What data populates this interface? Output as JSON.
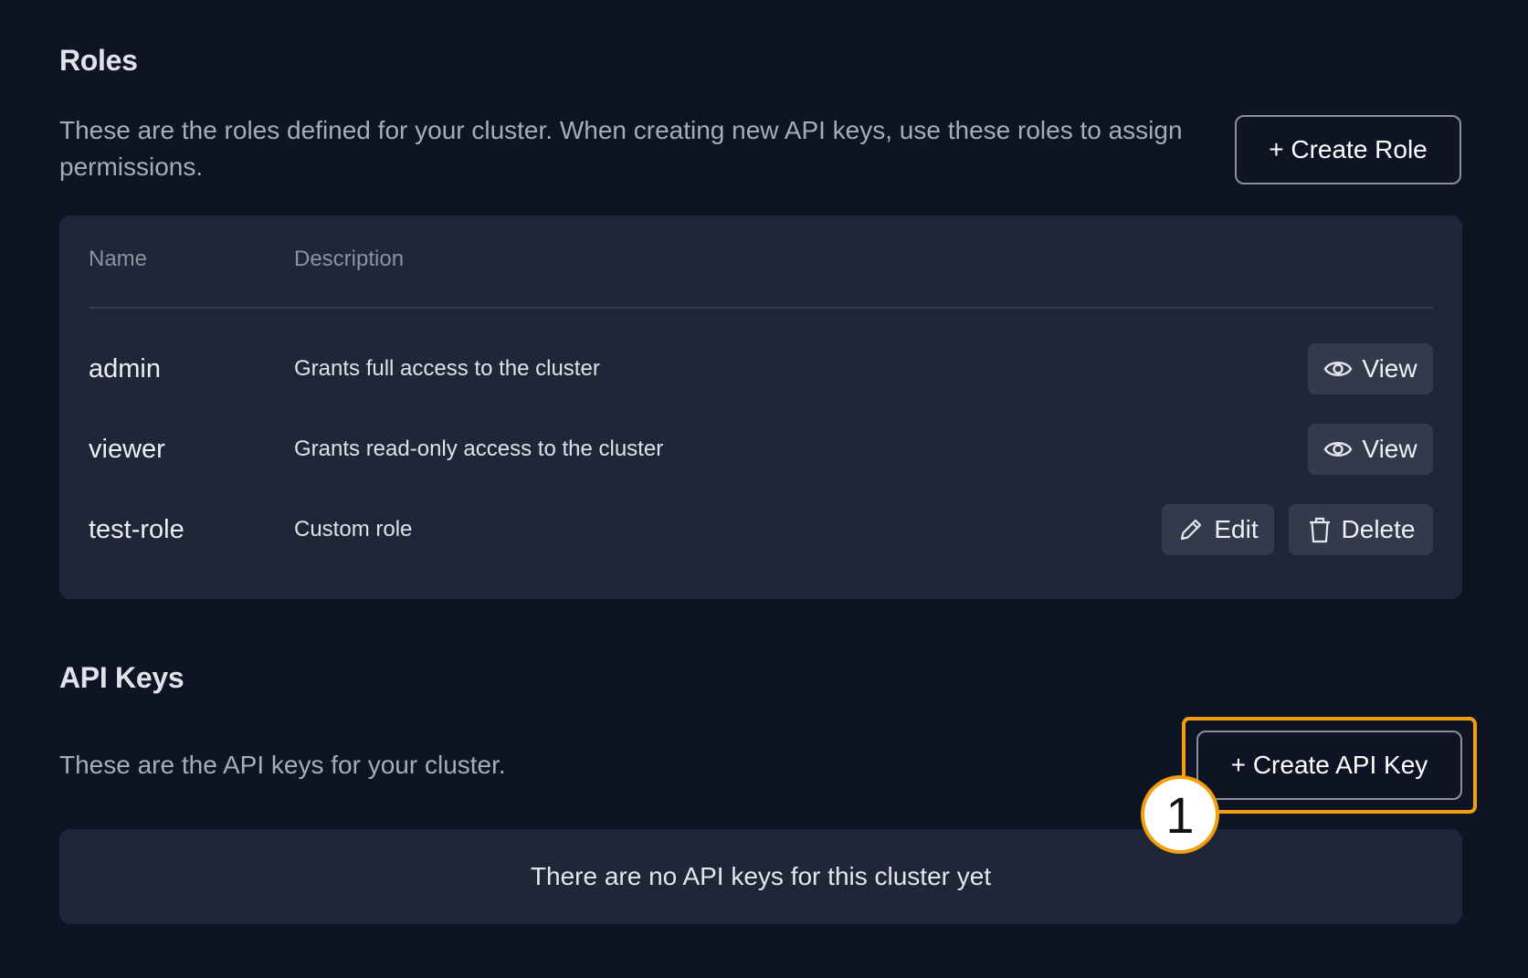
{
  "roles": {
    "title": "Roles",
    "description": "These are the roles defined for your cluster. When creating new API keys, use these roles to assign permissions.",
    "create_button": "+ Create Role",
    "columns": {
      "name": "Name",
      "description": "Description"
    },
    "rows": [
      {
        "name": "admin",
        "description": "Grants full access to the cluster",
        "actions": [
          {
            "label": "View",
            "icon": "eye-icon"
          }
        ]
      },
      {
        "name": "viewer",
        "description": "Grants read-only access to the cluster",
        "actions": [
          {
            "label": "View",
            "icon": "eye-icon"
          }
        ]
      },
      {
        "name": "test-role",
        "description": "Custom role",
        "actions": [
          {
            "label": "Edit",
            "icon": "pencil-icon"
          },
          {
            "label": "Delete",
            "icon": "trash-icon"
          }
        ]
      }
    ]
  },
  "api_keys": {
    "title": "API Keys",
    "description": "These are the API keys for your cluster.",
    "create_button": "+ Create API Key",
    "empty_message": "There are no API keys for this cluster yet"
  },
  "annotation": {
    "step_number": "1",
    "color": "#f59e0b"
  },
  "colors": {
    "background": "#0e1424",
    "card": "#1f2638",
    "button": "#323a4c"
  }
}
